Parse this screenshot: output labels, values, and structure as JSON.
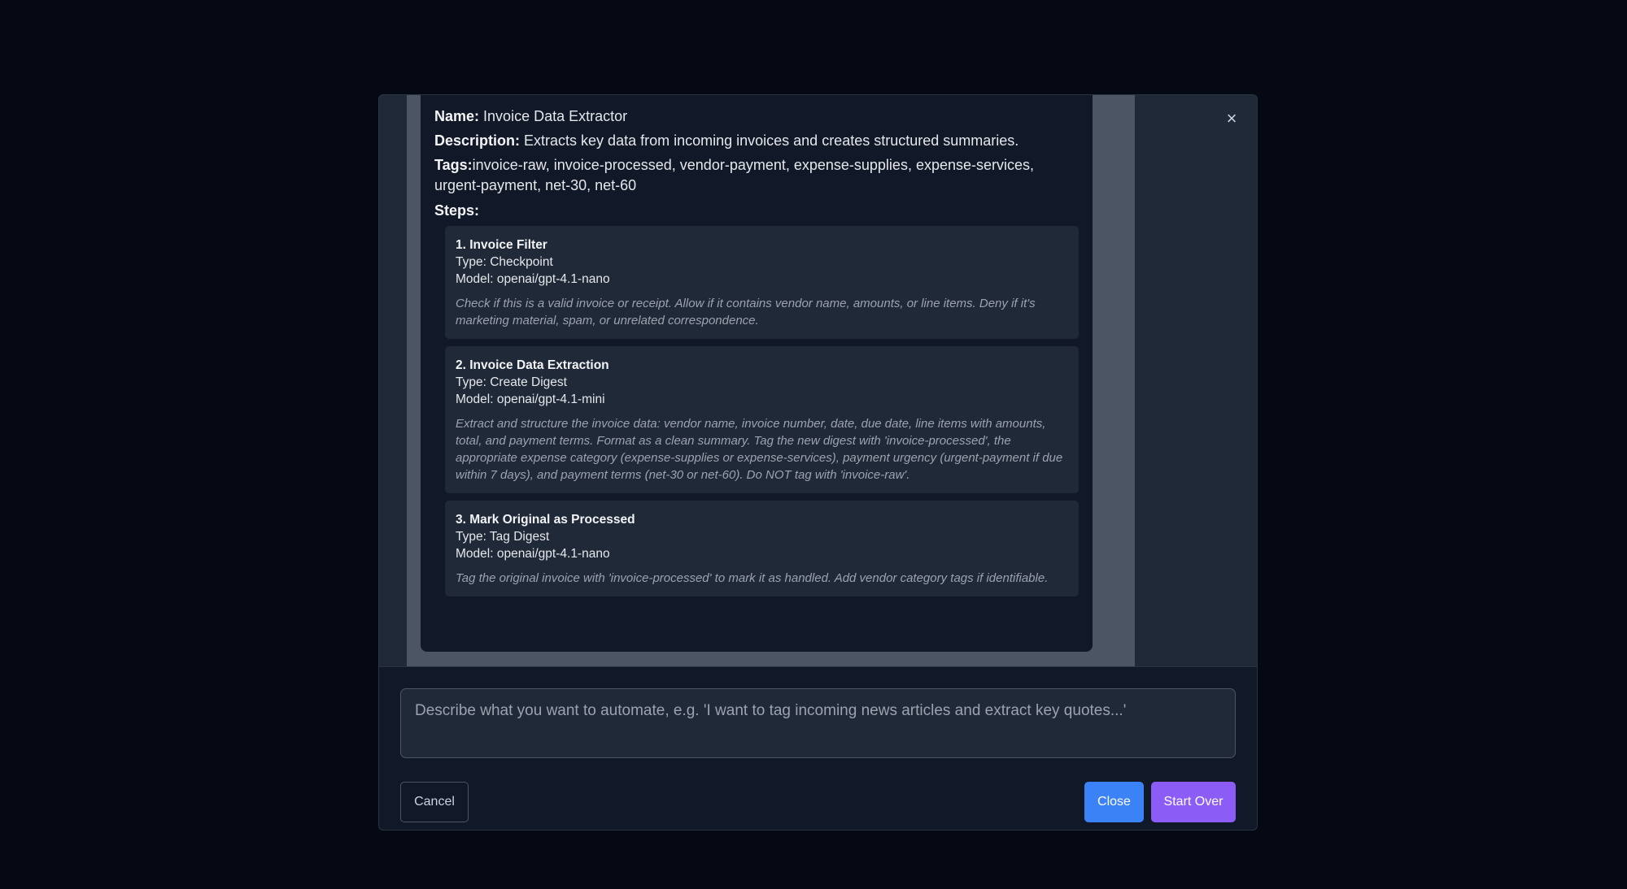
{
  "modal": {
    "close_glyph": "×"
  },
  "workflow": {
    "name_label": "Name:",
    "name": "Invoice Data Extractor",
    "description_label": "Description:",
    "description": "Extracts key data from incoming invoices and creates structured summaries.",
    "tags_label": "Tags:",
    "tags": "invoice-raw, invoice-processed, vendor-payment, expense-supplies, expense-services, urgent-payment, net-30, net-60",
    "steps_label": "Steps:",
    "steps": [
      {
        "title": "1. Invoice Filter",
        "type": "Type: Checkpoint",
        "model": "Model: openai/gpt-4.1-nano",
        "description": "Check if this is a valid invoice or receipt. Allow if it contains vendor name, amounts, or line items. Deny if it's marketing material, spam, or unrelated correspondence."
      },
      {
        "title": "2. Invoice Data Extraction",
        "type": "Type: Create Digest",
        "model": "Model: openai/gpt-4.1-mini",
        "description": "Extract and structure the invoice data: vendor name, invoice number, date, due date, line items with amounts, total, and payment terms. Format as a clean summary. Tag the new digest with 'invoice-processed', the appropriate expense category (expense-supplies or expense-services), payment urgency (urgent-payment if due within 7 days), and payment terms (net-30 or net-60). Do NOT tag with 'invoice-raw'."
      },
      {
        "title": "3. Mark Original as Processed",
        "type": "Type: Tag Digest",
        "model": "Model: openai/gpt-4.1-nano",
        "description": "Tag the original invoice with 'invoice-processed' to mark it as handled. Add vendor category tags if identifiable."
      }
    ]
  },
  "footer": {
    "prompt_placeholder": "Describe what you want to automate, e.g. 'I want to tag incoming news articles and extract key quotes...'",
    "cancel_label": "Cancel",
    "close_label": "Close",
    "start_over_label": "Start Over"
  },
  "colors": {
    "background": "#050914",
    "modal": "#1f2937",
    "card": "#111827",
    "close_button": "#3b82f6",
    "start_over_button": "#8b5cf6"
  }
}
